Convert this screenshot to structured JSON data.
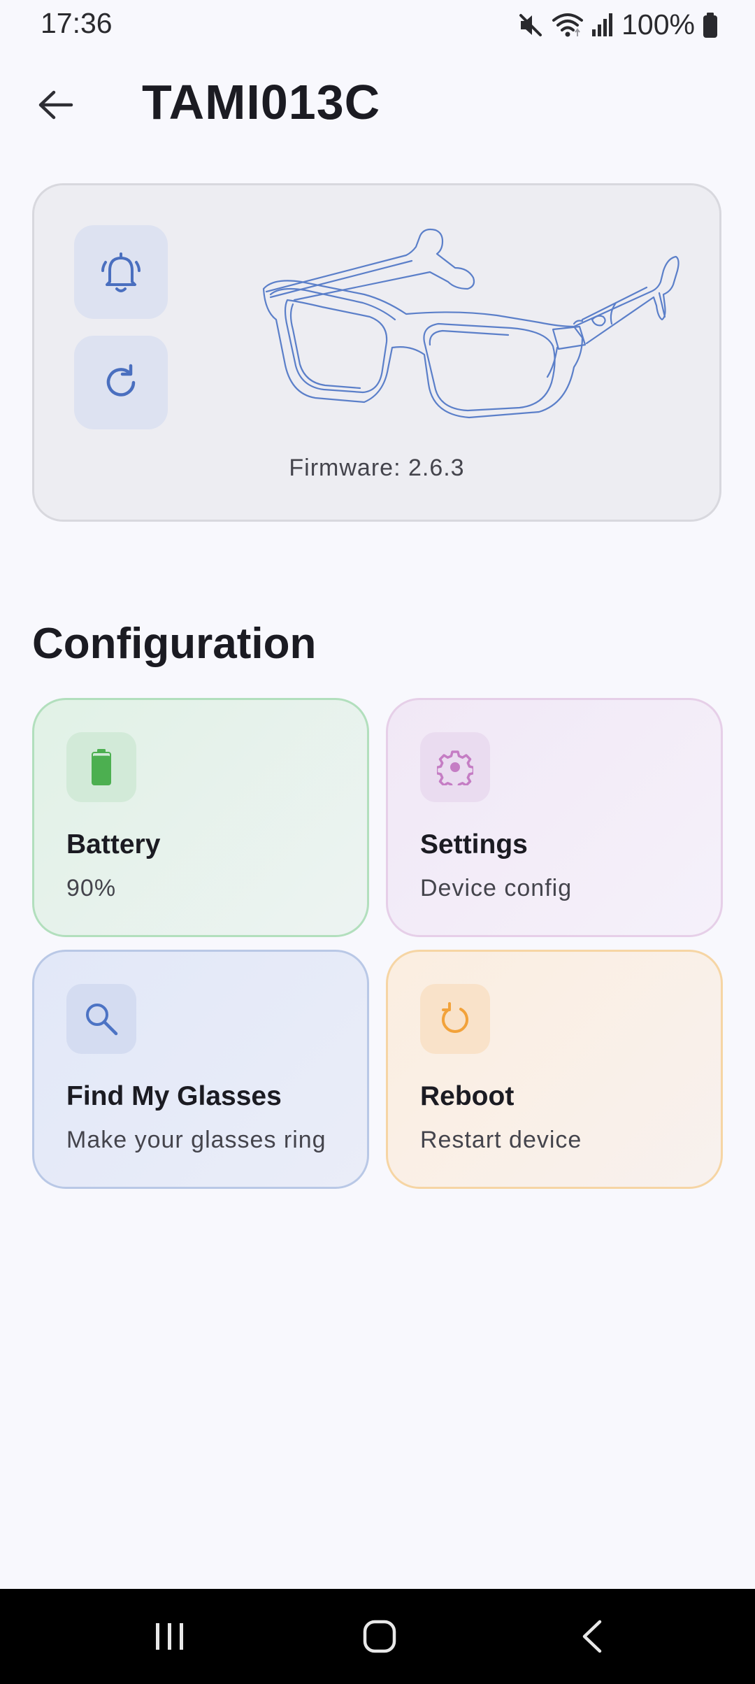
{
  "status_bar": {
    "time": "17:36",
    "battery_text": "100%",
    "icons": [
      "mute-icon",
      "wifi-icon",
      "signal-icon",
      "battery-icon"
    ]
  },
  "app_bar": {
    "title": "TAMI013C",
    "back_icon": "arrow-left-icon"
  },
  "device_card": {
    "firmware_label": "Firmware:",
    "firmware_version": "2.6.3",
    "buttons": [
      "bell-icon",
      "refresh-icon"
    ],
    "image": "smart-glasses-illustration"
  },
  "configuration": {
    "title": "Configuration",
    "tiles": [
      {
        "title": "Battery",
        "subtitle": "90%",
        "icon": "battery-icon",
        "level": 0.9,
        "accent": "#4caf50"
      },
      {
        "title": "Settings",
        "subtitle": "Device config",
        "icon": "gear-icon",
        "accent": "#c57dc4"
      },
      {
        "title": "Find My Glasses",
        "subtitle": "Make your glasses ring",
        "icon": "search-icon",
        "accent": "#4c73c4"
      },
      {
        "title": "Reboot",
        "subtitle": "Restart device",
        "icon": "restart-icon",
        "accent": "#f2a23a"
      }
    ]
  },
  "nav_bar": {
    "icons": [
      "recents-icon",
      "home-icon",
      "back-icon"
    ]
  }
}
